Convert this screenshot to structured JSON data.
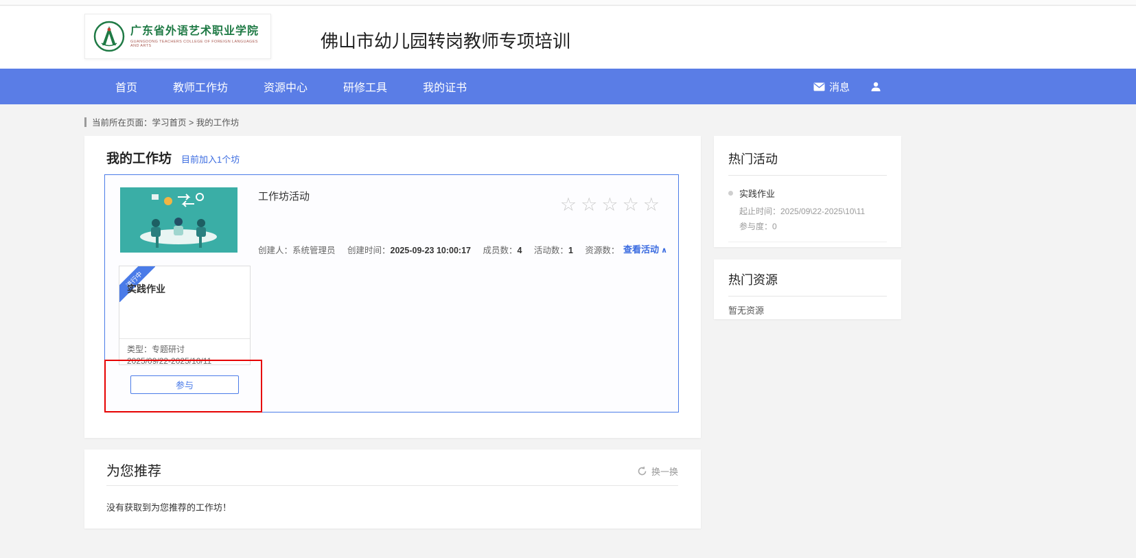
{
  "header": {
    "logo_cn": "广东省外语艺术职业学院",
    "logo_en": "GUANGDONG TEACHERS COLLEGE OF FOREIGN LANGUAGES AND ARTS",
    "title": "佛山市幼儿园转岗教师专项培训"
  },
  "nav": {
    "items": [
      {
        "label": "首页"
      },
      {
        "label": "教师工作坊"
      },
      {
        "label": "资源中心"
      },
      {
        "label": "研修工具"
      },
      {
        "label": "我的证书"
      }
    ],
    "messages_label": "消息"
  },
  "breadcrumb": {
    "text": "当前所在页面：学习首页 > 我的工作坊"
  },
  "workshop_panel": {
    "title": "我的工作坊",
    "subtitle": "目前加入1个坊",
    "workshop": {
      "name": "工作坊活动",
      "meta": {
        "creator_label": "创建人：",
        "creator": "系统管理员",
        "created_label": "创建时间：",
        "created": "2025-09-23 10:00:17",
        "members_label": "成员数：",
        "members": "4",
        "activities_label": "活动数：",
        "activities": "1",
        "resources_label": "资源数："
      },
      "view_activity": "查看活动",
      "activity_card": {
        "ribbon": "进行中",
        "title": "实践作业",
        "type": "类型：专题研讨",
        "dates": "2025/09/22-2025/10/11",
        "join_button": "参与"
      }
    }
  },
  "hot_activities": {
    "title": "热门活动",
    "items": [
      {
        "name": "实践作业",
        "time": "起止时间：2025/09\\22-2025\\10\\11",
        "participation": "参与度：0"
      }
    ]
  },
  "hot_resources": {
    "title": "热门资源",
    "empty": "暂无资源"
  },
  "recommend": {
    "title": "为您推荐",
    "refresh_label": "换一换",
    "empty": "没有获取到为您推荐的工作坊！"
  },
  "icons": {
    "star": "☆",
    "chevron_up": "∧"
  },
  "colors": {
    "nav_blue": "#5a7de6",
    "link_blue": "#3a6be0",
    "accent_border_blue": "#4a7be8",
    "annotation_red": "#e60000",
    "logo_green": "#1f7a45"
  }
}
